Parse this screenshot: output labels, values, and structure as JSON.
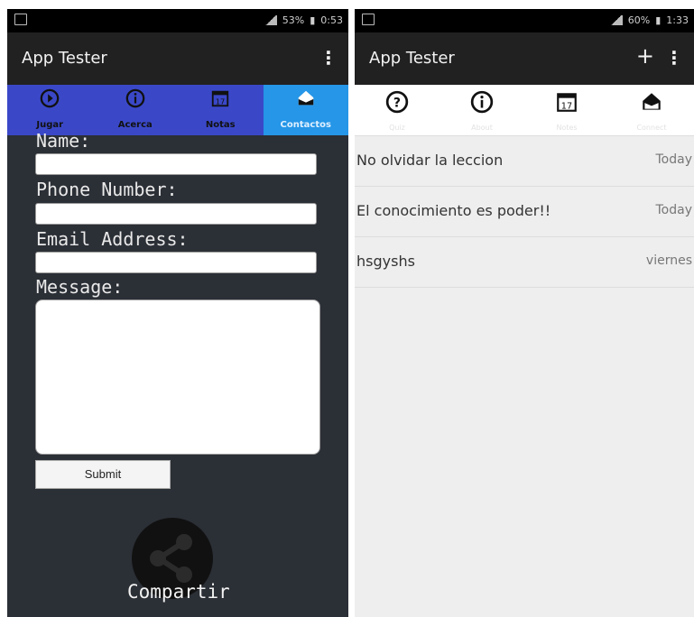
{
  "left": {
    "status": {
      "battery": "53%",
      "time": "0:53"
    },
    "appbar": {
      "title": "App Tester"
    },
    "tabs": [
      {
        "label": "Jugar",
        "icon": "play-icon"
      },
      {
        "label": "Acerca",
        "icon": "info-icon"
      },
      {
        "label": "Notas",
        "icon": "calendar-icon",
        "day": "17"
      },
      {
        "label": "Contactos",
        "icon": "contact-icon"
      }
    ],
    "form": {
      "name_label": "Name:",
      "phone_label": "Phone Number:",
      "email_label": "Email Address:",
      "message_label": "Message:",
      "submit_label": "Submit"
    },
    "share_label": "Compartir"
  },
  "right": {
    "status": {
      "battery": "60%",
      "time": "1:33"
    },
    "appbar": {
      "title": "App Tester",
      "add": "+"
    },
    "tabs": [
      {
        "label": "Quiz",
        "icon": "help-icon"
      },
      {
        "label": "About",
        "icon": "info-icon"
      },
      {
        "label": "Notes",
        "icon": "calendar-icon",
        "day": "17"
      },
      {
        "label": "Connect",
        "icon": "contact-icon"
      }
    ],
    "notes": [
      {
        "title": "No olvidar la leccion",
        "date": "Today"
      },
      {
        "title": "El conocimiento es poder!!",
        "date": "Today"
      },
      {
        "title": "hsgyshs",
        "date": "viernes"
      }
    ]
  },
  "colors": {
    "form_background": "#2b2f36",
    "tab_bar_left": "#3a48c8",
    "active_tab": "#2596e8",
    "app_bar": "#212121",
    "notes_background": "#eeeeee"
  }
}
